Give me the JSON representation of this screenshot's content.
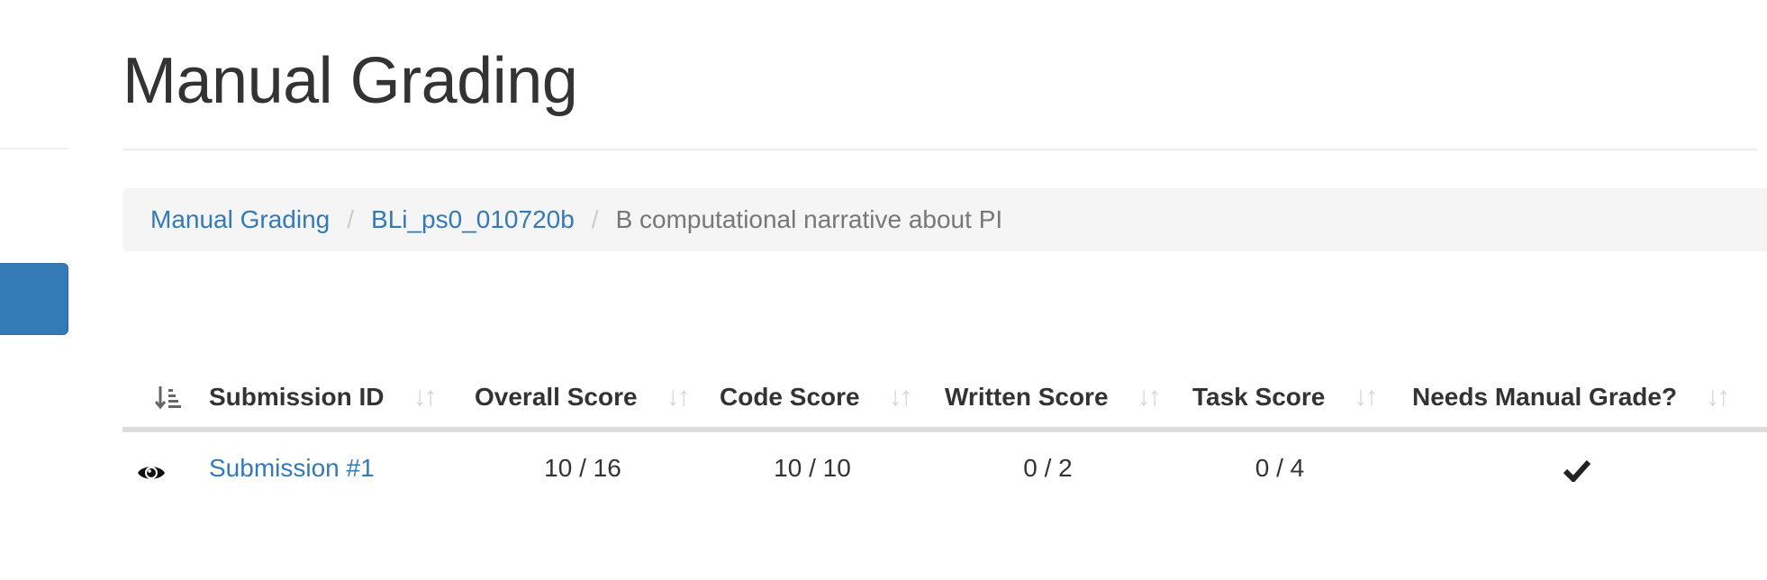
{
  "page": {
    "title": "Manual Grading"
  },
  "breadcrumb": {
    "items": [
      {
        "label": "Manual Grading",
        "link": true
      },
      {
        "label": "BLi_ps0_010720b",
        "link": true
      },
      {
        "label": "B computational narrative about PI",
        "link": false
      }
    ],
    "separator": "/"
  },
  "table": {
    "columns": [
      {
        "label": "",
        "icon": "sort-amount-icon"
      },
      {
        "label": "Submission ID",
        "icon": "sort-icon"
      },
      {
        "label": "Overall Score",
        "icon": "sort-icon"
      },
      {
        "label": "Code Score",
        "icon": "sort-icon"
      },
      {
        "label": "Written Score",
        "icon": "sort-icon"
      },
      {
        "label": "Task Score",
        "icon": "sort-icon"
      },
      {
        "label": "Needs Manual Grade?",
        "icon": "sort-icon"
      }
    ],
    "rows": [
      {
        "view_icon": "eye-icon",
        "submission": "Submission #1",
        "overall_score": "10 / 16",
        "code_score": "10 / 10",
        "written_score": "0 / 2",
        "task_score": "0 / 4",
        "needs_manual_grade_icon": "check-icon"
      }
    ]
  },
  "colors": {
    "link": "#337ab7",
    "sidebar_button": "#337ab7",
    "breadcrumb_bg": "#f5f5f5",
    "sort_icon": "#d6d6d6"
  }
}
